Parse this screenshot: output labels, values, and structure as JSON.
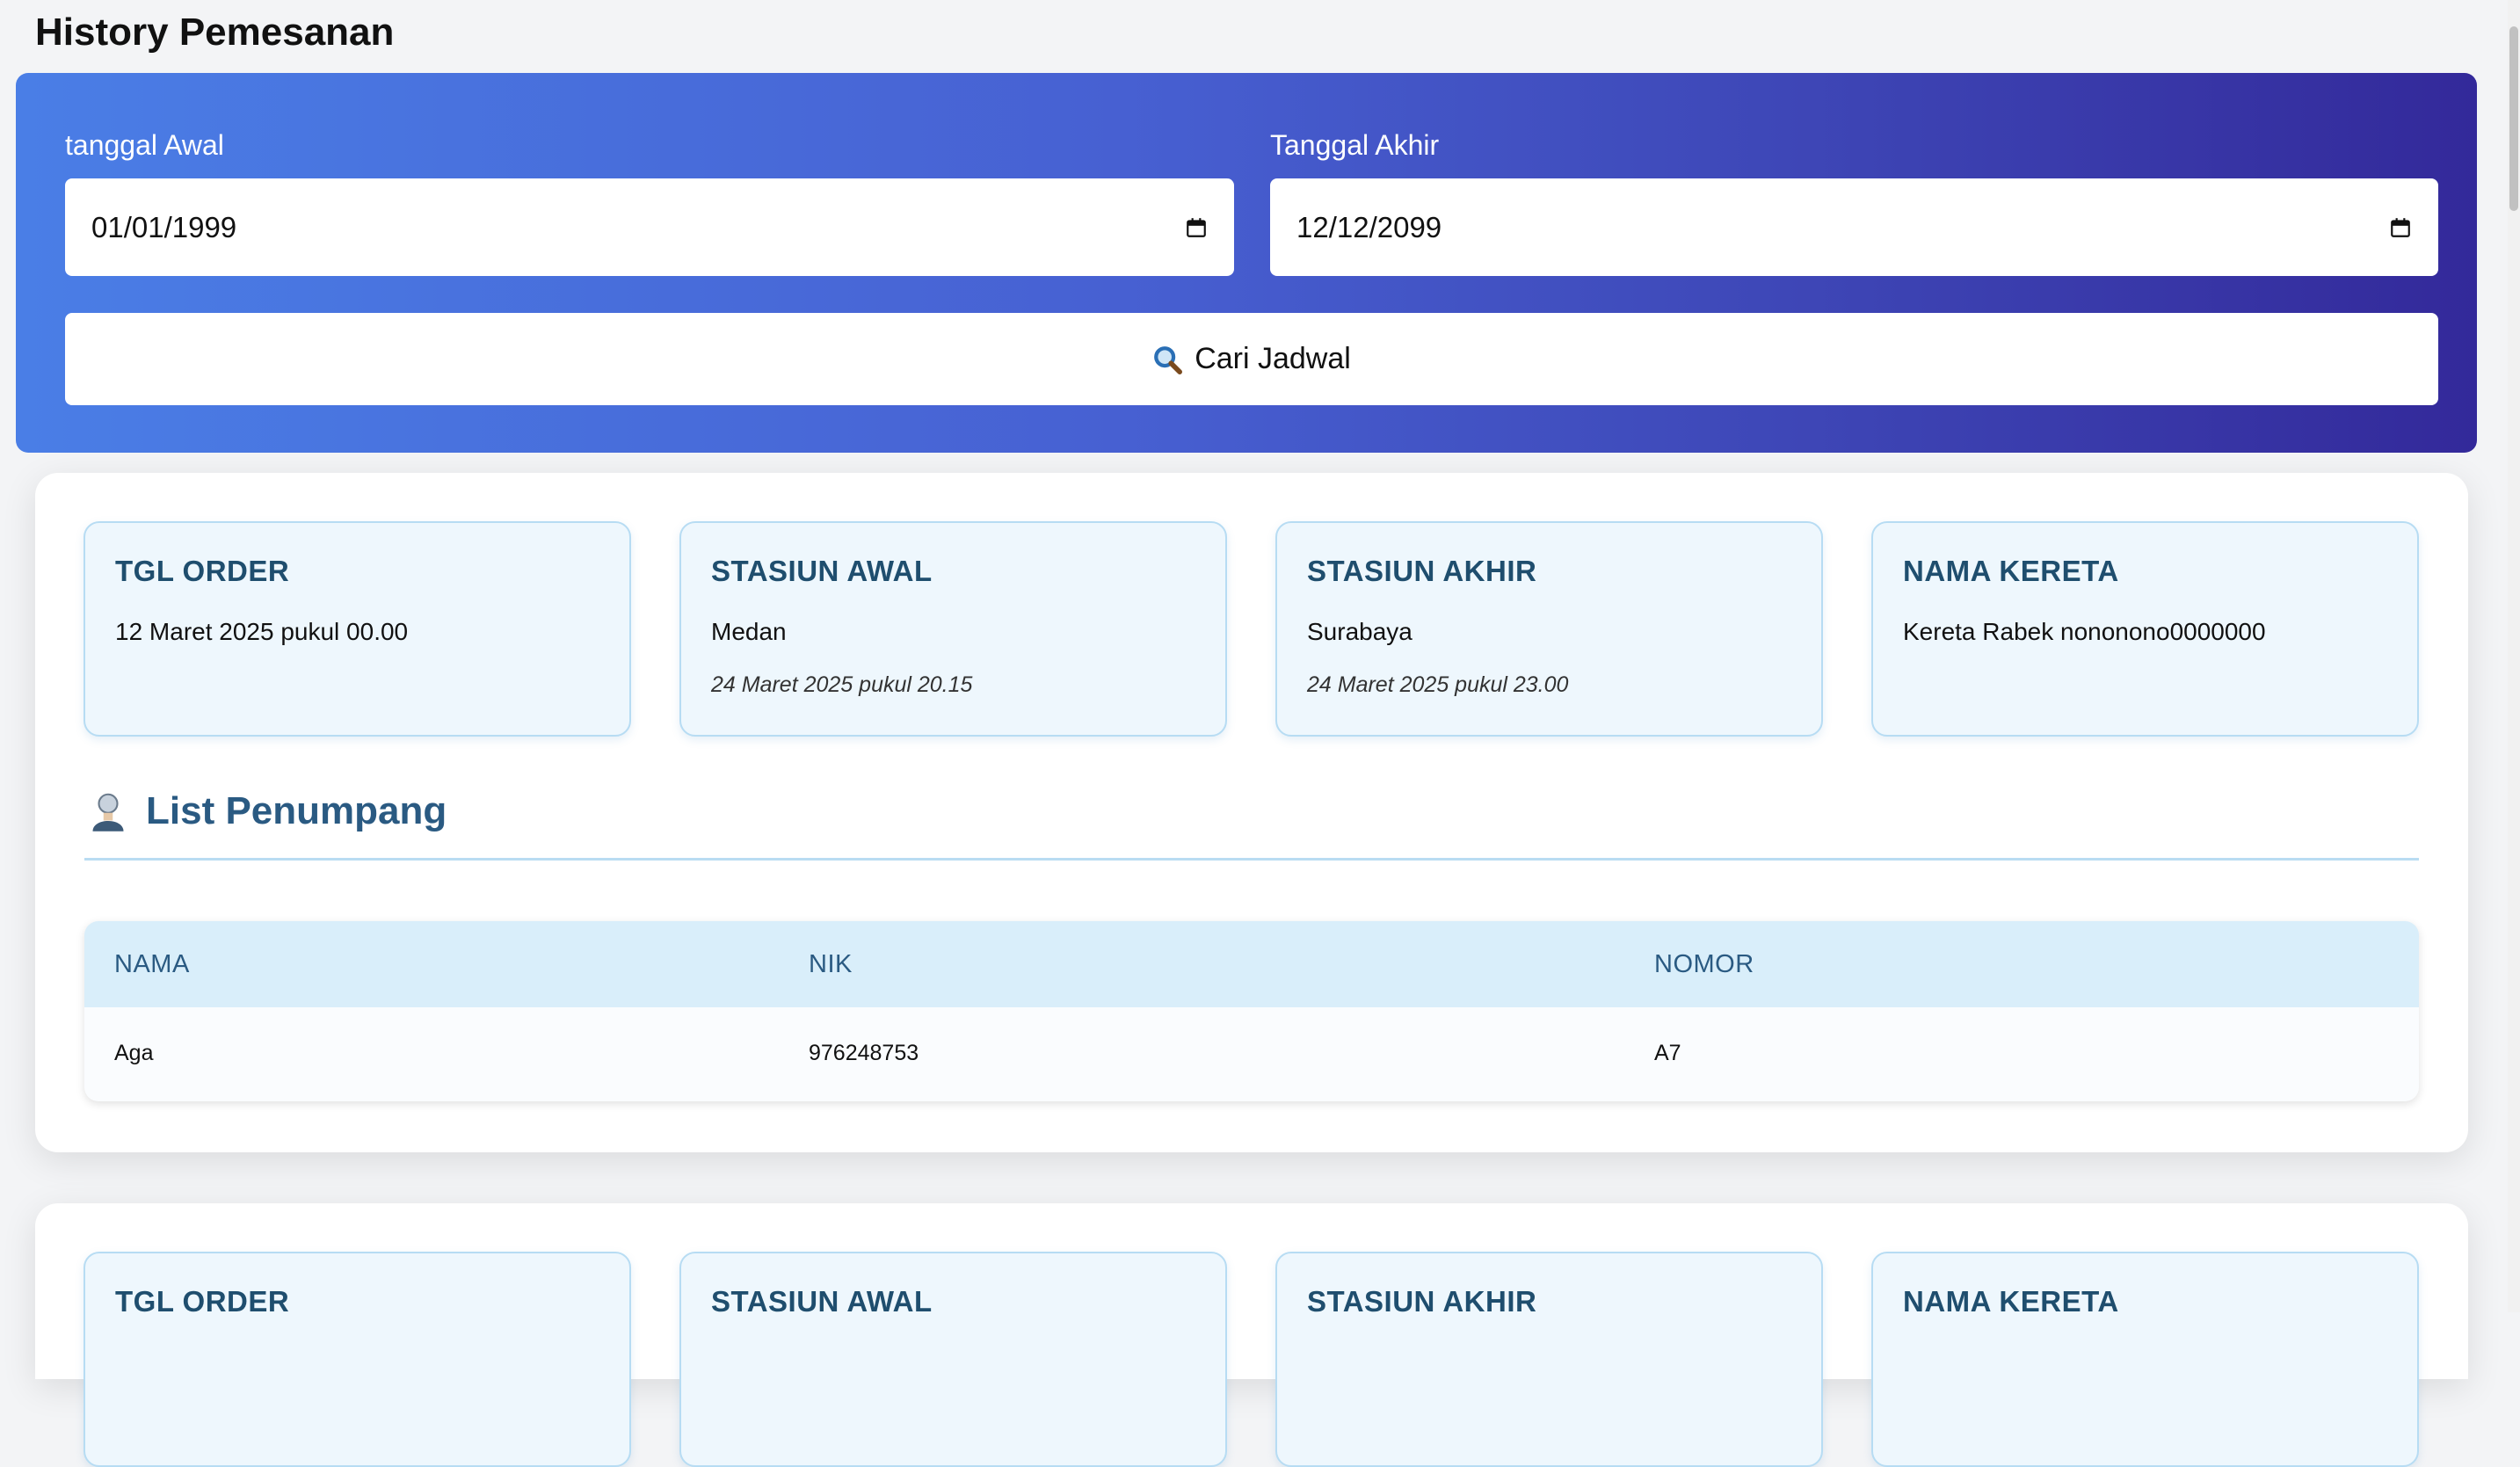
{
  "page": {
    "title": "History Pemesanan"
  },
  "search": {
    "start_label": "tanggal Awal",
    "start_value": "01/01/1999",
    "end_label": "Tanggal Akhir",
    "end_value": "12/12/2099",
    "button_label": "Cari Jadwal",
    "button_icon": "magnifier-icon",
    "date_icon": "calendar-icon",
    "colors": {
      "gradient_start": "#4a7ee6",
      "gradient_end": "#33299a"
    }
  },
  "orders": [
    {
      "tgl_order_label": "TGL ORDER",
      "tgl_order_value": "12 Maret 2025 pukul 00.00",
      "stasiun_awal_label": "STASIUN AWAL",
      "stasiun_awal_value": "Medan",
      "stasiun_awal_time": "24 Maret 2025 pukul 20.15",
      "stasiun_akhir_label": "STASIUN AKHIR",
      "stasiun_akhir_value": "Surabaya",
      "stasiun_akhir_time": "24 Maret 2025 pukul 23.00",
      "nama_kereta_label": "NAMA KERETA",
      "nama_kereta_value": "Kereta Rabek nononono0000000",
      "passenger_heading": "List Penumpang",
      "passenger_icon": "person-icon",
      "table": {
        "headers": [
          "NAMA",
          "NIK",
          "NOMOR"
        ],
        "rows": [
          [
            "Aga",
            "976248753",
            "A7"
          ]
        ]
      }
    },
    {
      "tgl_order_label": "TGL ORDER",
      "stasiun_awal_label": "STASIUN AWAL",
      "stasiun_akhir_label": "STASIUN AKHIR",
      "nama_kereta_label": "NAMA KERETA"
    }
  ]
}
